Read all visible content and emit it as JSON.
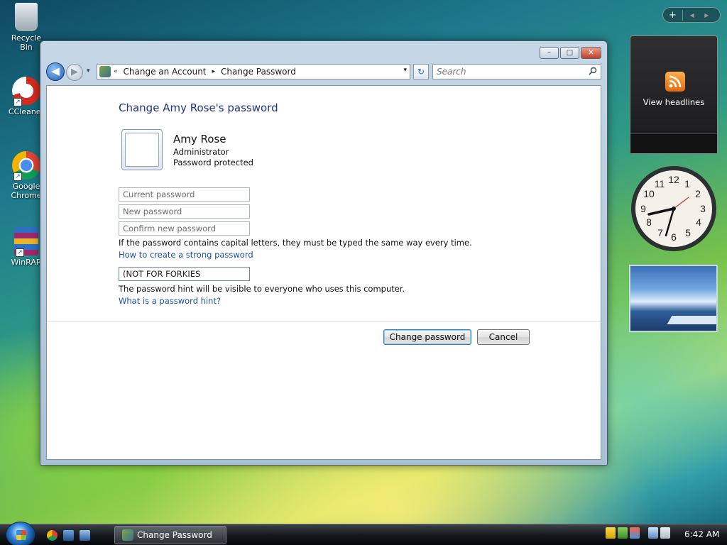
{
  "desktop": {
    "icons": [
      {
        "label": "Recycle Bin"
      },
      {
        "label": "CCleaner"
      },
      {
        "label": "Google Chrome"
      },
      {
        "label": "WinRAR"
      }
    ]
  },
  "window": {
    "controls": {
      "minimize": "–",
      "maximize": "□",
      "close": "✕"
    },
    "nav": {
      "back": "◀",
      "forward": "▶",
      "dropdown": "▾",
      "breadcrumb_prefix": "«",
      "breadcrumb": [
        "Change an Account",
        "Change Password"
      ],
      "separator": "▸",
      "address_dropdown": "▾",
      "refresh": "↻",
      "search_placeholder": "Search"
    }
  },
  "form": {
    "heading": "Change Amy Rose's password",
    "user": {
      "name": "Amy Rose",
      "role": "Administrator",
      "status": "Password protected"
    },
    "current_password_placeholder": "Current password",
    "new_password_placeholder": "New password",
    "confirm_password_placeholder": "Confirm new password",
    "caps_note": "If the password contains capital letters, they must be typed the same way every time.",
    "strong_link": "How to create a strong password",
    "hint_value": "(NOT FOR FORKIES",
    "hint_note": "The password hint will be visible to everyone who uses this computer.",
    "hint_link": "What is a password hint?",
    "change_button": "Change password",
    "cancel_button": "Cancel"
  },
  "gadgets": {
    "toolbar_plus": "+",
    "toolbar_arrows": "◀ ▶",
    "feed_label": "View headlines"
  },
  "taskbar": {
    "task_label": "Change Password",
    "time": "6:42 AM"
  },
  "colors": {
    "link": "#1f4fa8",
    "heading": "#1e3287"
  }
}
